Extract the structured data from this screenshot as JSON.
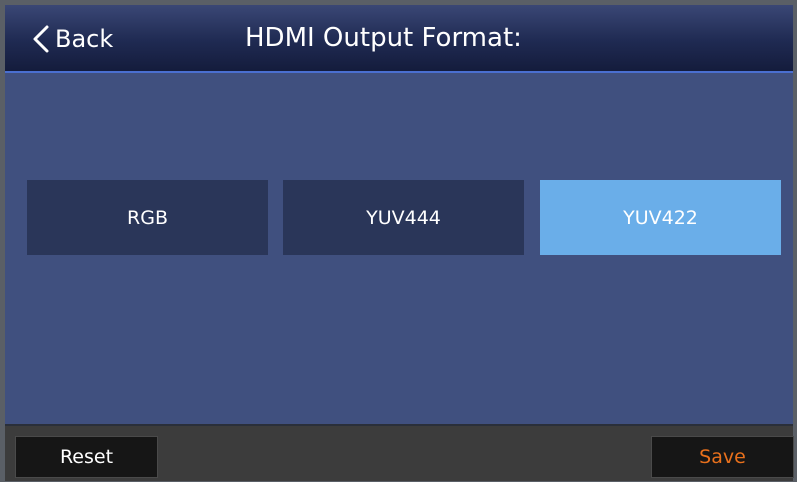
{
  "header": {
    "back_label": "Back",
    "title": "HDMI Output Format:"
  },
  "options": [
    {
      "label": "RGB",
      "selected": false
    },
    {
      "label": "YUV444",
      "selected": false
    },
    {
      "label": "YUV422",
      "selected": true
    }
  ],
  "footer": {
    "reset_label": "Reset",
    "save_label": "Save"
  },
  "colors": {
    "header_bg": "#1f2a52",
    "content_bg": "#40507f",
    "option_bg": "#2a3659",
    "option_selected_bg": "#6aaee9",
    "save_text": "#e8701c"
  }
}
